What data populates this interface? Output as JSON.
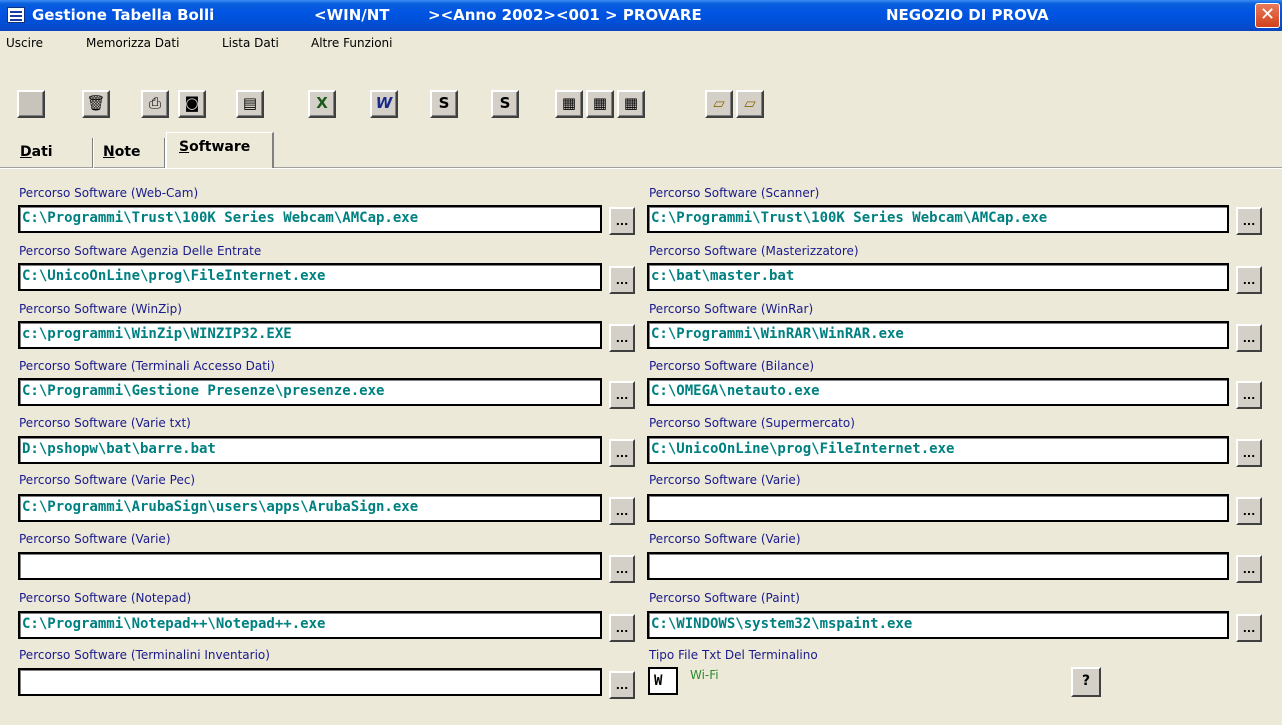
{
  "window": {
    "title": "Gestione Tabella Bolli",
    "platform": "<WIN/NT",
    "year_info": "><Anno 2002><001 > PROVARE",
    "store": "NEGOZIO DI PROVA",
    "close_glyph": "✕"
  },
  "menu": [
    "Uscire",
    "Memorizza Dati",
    "Lista Dati",
    "Altre Funzioni"
  ],
  "toolbar_icons": [
    {
      "name": "blank",
      "glyph": ""
    },
    {
      "name": "trash",
      "glyph": "🗑"
    },
    {
      "name": "printer",
      "glyph": "⎙"
    },
    {
      "name": "preview",
      "glyph": "◙"
    },
    {
      "name": "documents",
      "glyph": "▤"
    },
    {
      "name": "excel",
      "glyph": "X"
    },
    {
      "name": "word",
      "glyph": "W"
    },
    {
      "name": "export1",
      "glyph": "S"
    },
    {
      "name": "export2",
      "glyph": "S"
    },
    {
      "name": "clipboard1",
      "glyph": "▦"
    },
    {
      "name": "clipboard2",
      "glyph": "▦"
    },
    {
      "name": "clipboard3",
      "glyph": "▦"
    },
    {
      "name": "folder-open1",
      "glyph": "▱"
    },
    {
      "name": "folder-open2",
      "glyph": "▱"
    }
  ],
  "tabs": {
    "dati_prefix": "D",
    "dati_rest": "ati",
    "note_prefix": "N",
    "note_rest": "ote",
    "software_prefix": "S",
    "software_rest": "oftware"
  },
  "fields_left": [
    {
      "label": "Percorso Software (Web-Cam)",
      "value": "C:\\Programmi\\Trust\\100K Series Webcam\\AMCap.exe"
    },
    {
      "label": "Percorso Software Agenzia Delle Entrate",
      "value": "C:\\UnicoOnLine\\prog\\FileInternet.exe"
    },
    {
      "label": "Percorso Software (WinZip)",
      "value": "c:\\programmi\\WinZip\\WINZIP32.EXE"
    },
    {
      "label": "Percorso Software (Terminali Accesso Dati)",
      "value": "C:\\Programmi\\Gestione Presenze\\presenze.exe"
    },
    {
      "label": "Percorso Software (Varie txt)",
      "value": "D:\\pshopw\\bat\\barre.bat"
    },
    {
      "label": "Percorso Software (Varie Pec)",
      "value": "C:\\Programmi\\ArubaSign\\users\\apps\\ArubaSign.exe"
    },
    {
      "label": "Percorso Software (Varie)",
      "value": ""
    },
    {
      "label": "Percorso Software (Notepad)",
      "value": "C:\\Programmi\\Notepad++\\Notepad++.exe"
    },
    {
      "label": "Percorso Software (Terminalini Inventario)",
      "value": ""
    }
  ],
  "fields_right": [
    {
      "label": "Percorso Software (Scanner)",
      "value": "C:\\Programmi\\Trust\\100K Series Webcam\\AMCap.exe"
    },
    {
      "label": "Percorso Software (Masterizzatore)",
      "value": "c:\\bat\\master.bat"
    },
    {
      "label": "Percorso Software (WinRar)",
      "value": "C:\\Programmi\\WinRAR\\WinRAR.exe"
    },
    {
      "label": "Percorso Software (Bilance)",
      "value": "C:\\OMEGA\\netauto.exe"
    },
    {
      "label": "Percorso Software (Supermercato)",
      "value": "C:\\UnicoOnLine\\prog\\FileInternet.exe"
    },
    {
      "label": "Percorso Software (Varie)",
      "value": ""
    },
    {
      "label": "Percorso Software (Varie)",
      "value": ""
    },
    {
      "label": "Percorso Software (Paint)",
      "value": "C:\\WINDOWS\\system32\\mspaint.exe"
    }
  ],
  "browse_label": "...",
  "terminal_type": {
    "label": "Tipo File Txt Del Terminalino",
    "value": "W",
    "description": "Wi-Fi",
    "help_label": "?"
  }
}
